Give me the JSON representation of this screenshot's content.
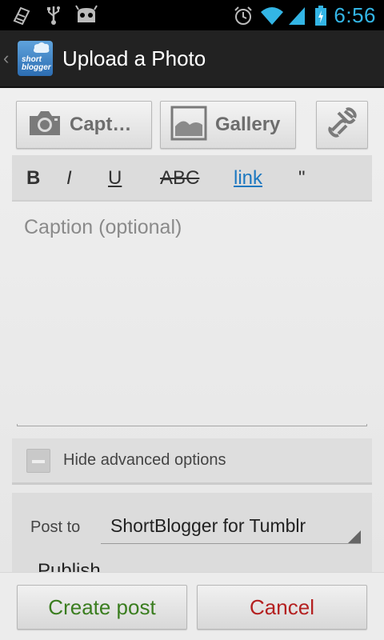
{
  "status_bar": {
    "time": "6:56",
    "accent_color": "#33b5e5",
    "left_icons": [
      "notification-icon",
      "usb-icon",
      "android-debug-icon"
    ],
    "right_icons": [
      "alarm-icon",
      "wifi-icon",
      "signal-icon",
      "battery-charging-icon"
    ]
  },
  "action_bar": {
    "title": "Upload a Photo",
    "app_icon_text_1": "short",
    "app_icon_text_2": "blogger"
  },
  "media_buttons": {
    "capture_label": "Capt…",
    "gallery_label": "Gallery"
  },
  "format_bar": {
    "bold": "B",
    "italic": "I",
    "underline": "U",
    "strike": "ABC",
    "link": "link",
    "quote": "\""
  },
  "caption": {
    "placeholder": "Caption (optional)",
    "value": ""
  },
  "advanced": {
    "toggle_label": "Hide advanced options",
    "post_to_label": "Post to",
    "post_to_value": "ShortBlogger for Tumblr",
    "publish_partial": "Publish"
  },
  "actions": {
    "create_label": "Create post",
    "cancel_label": "Cancel",
    "create_color": "#3a7d1f",
    "cancel_color": "#b42020"
  }
}
